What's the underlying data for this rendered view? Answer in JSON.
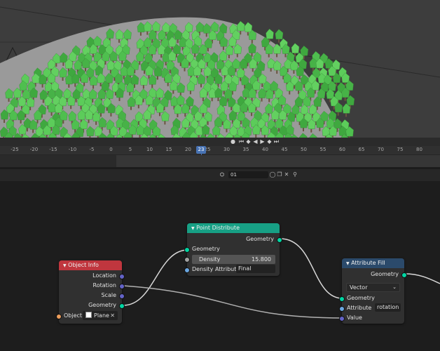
{
  "timeline": {
    "ticks": [
      "-25",
      "-20",
      "-15",
      "-10",
      "-5",
      "0",
      "5",
      "10",
      "15",
      "20",
      "25",
      "30",
      "35",
      "40",
      "45",
      "50",
      "55",
      "60",
      "65",
      "70",
      "75",
      "80"
    ],
    "current_frame": "23",
    "transport_icons": [
      "record-icon",
      "jump-start-icon",
      "prev-keyframe-icon",
      "play-reverse-icon",
      "play-icon",
      "next-keyframe-icon",
      "jump-end-icon"
    ]
  },
  "node_header": {
    "tree_name": "01",
    "icons": [
      "node-tree-icon",
      "shield-icon",
      "copy-icon",
      "close-icon",
      "pin-icon"
    ]
  },
  "nodes": {
    "object_info": {
      "title": "Object Info",
      "outputs": [
        "Location",
        "Rotation",
        "Scale",
        "Geometry"
      ],
      "object_label": "Object:",
      "object_value": "Plane",
      "color": "#c0363e"
    },
    "point_distribute": {
      "title": "Point Distribute",
      "output": "Geometry",
      "input": "Geometry",
      "density_label": "Density",
      "density_value": "15.800",
      "density_attr_label": "Density Attribute",
      "density_attr_value": "Final",
      "color": "#17a085"
    },
    "attribute_fill": {
      "title": "Attribute Fill",
      "output": "Geometry",
      "type_value": "Vector",
      "input_geometry": "Geometry",
      "attribute_label": "Attribute",
      "attribute_value": "rotation",
      "value_label": "Value",
      "color": "#2b4a6b"
    }
  }
}
